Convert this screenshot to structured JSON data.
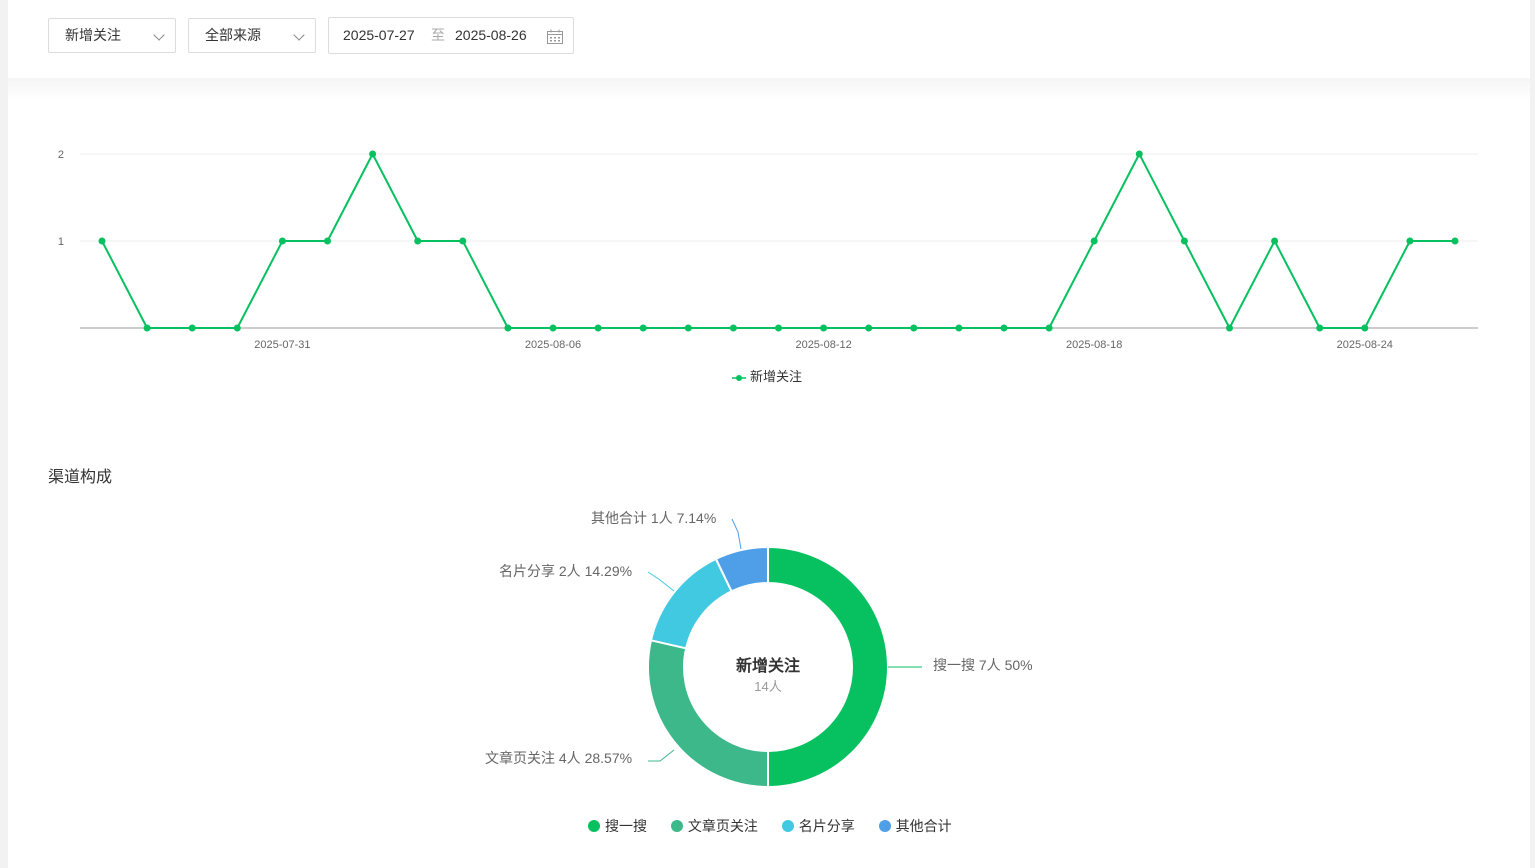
{
  "filters": {
    "metric_select": "新增关注",
    "source_select": "全部来源",
    "date_start": "2025-07-27",
    "date_separator": "至",
    "date_end": "2025-08-26"
  },
  "icons": {
    "dropdown": "chevron-down-icon",
    "calendar": "calendar-icon"
  },
  "colors": {
    "accent": "#07c160",
    "axis": "#bbbbbb",
    "grid": "#eeeeee",
    "pie": [
      "#07c160",
      "#3cb88b",
      "#40c9e0",
      "#4f9ee8"
    ]
  },
  "line_legend": "新增关注",
  "section_title": "渠道构成",
  "donut_center": {
    "title": "新增关注",
    "subtitle": "14人"
  },
  "chart_data": [
    {
      "type": "line",
      "title": "",
      "xlabel": "",
      "ylabel": "",
      "x": [
        "2025-07-27",
        "2025-07-28",
        "2025-07-29",
        "2025-07-30",
        "2025-07-31",
        "2025-08-01",
        "2025-08-02",
        "2025-08-03",
        "2025-08-04",
        "2025-08-05",
        "2025-08-06",
        "2025-08-07",
        "2025-08-08",
        "2025-08-09",
        "2025-08-10",
        "2025-08-11",
        "2025-08-12",
        "2025-08-13",
        "2025-08-14",
        "2025-08-15",
        "2025-08-16",
        "2025-08-17",
        "2025-08-18",
        "2025-08-19",
        "2025-08-20",
        "2025-08-21",
        "2025-08-22",
        "2025-08-23",
        "2025-08-24",
        "2025-08-25",
        "2025-08-26"
      ],
      "x_tick_labels": [
        "2025-07-31",
        "2025-08-06",
        "2025-08-12",
        "2025-08-18",
        "2025-08-24"
      ],
      "y_tick_labels": [
        "1",
        "2"
      ],
      "ylim": [
        0,
        2
      ],
      "grid": true,
      "legend_position": "bottom",
      "series": [
        {
          "name": "新增关注",
          "values": [
            1,
            0,
            0,
            0,
            1,
            1,
            2,
            1,
            1,
            0,
            0,
            0,
            0,
            0,
            0,
            0,
            0,
            0,
            0,
            0,
            0,
            0,
            1,
            2,
            1,
            0,
            1,
            0,
            0,
            1,
            1
          ]
        }
      ]
    },
    {
      "type": "pie",
      "title": "",
      "style": "donut",
      "legend_position": "bottom",
      "categories": [
        "搜一搜",
        "文章页关注",
        "名片分享",
        "其他合计"
      ],
      "values": [
        7,
        4,
        2,
        1
      ],
      "labels": [
        "搜一搜 7人 50%",
        "文章页关注 4人 28.57%",
        "名片分享 2人 14.29%",
        "其他合计 1人 7.14%"
      ]
    }
  ]
}
